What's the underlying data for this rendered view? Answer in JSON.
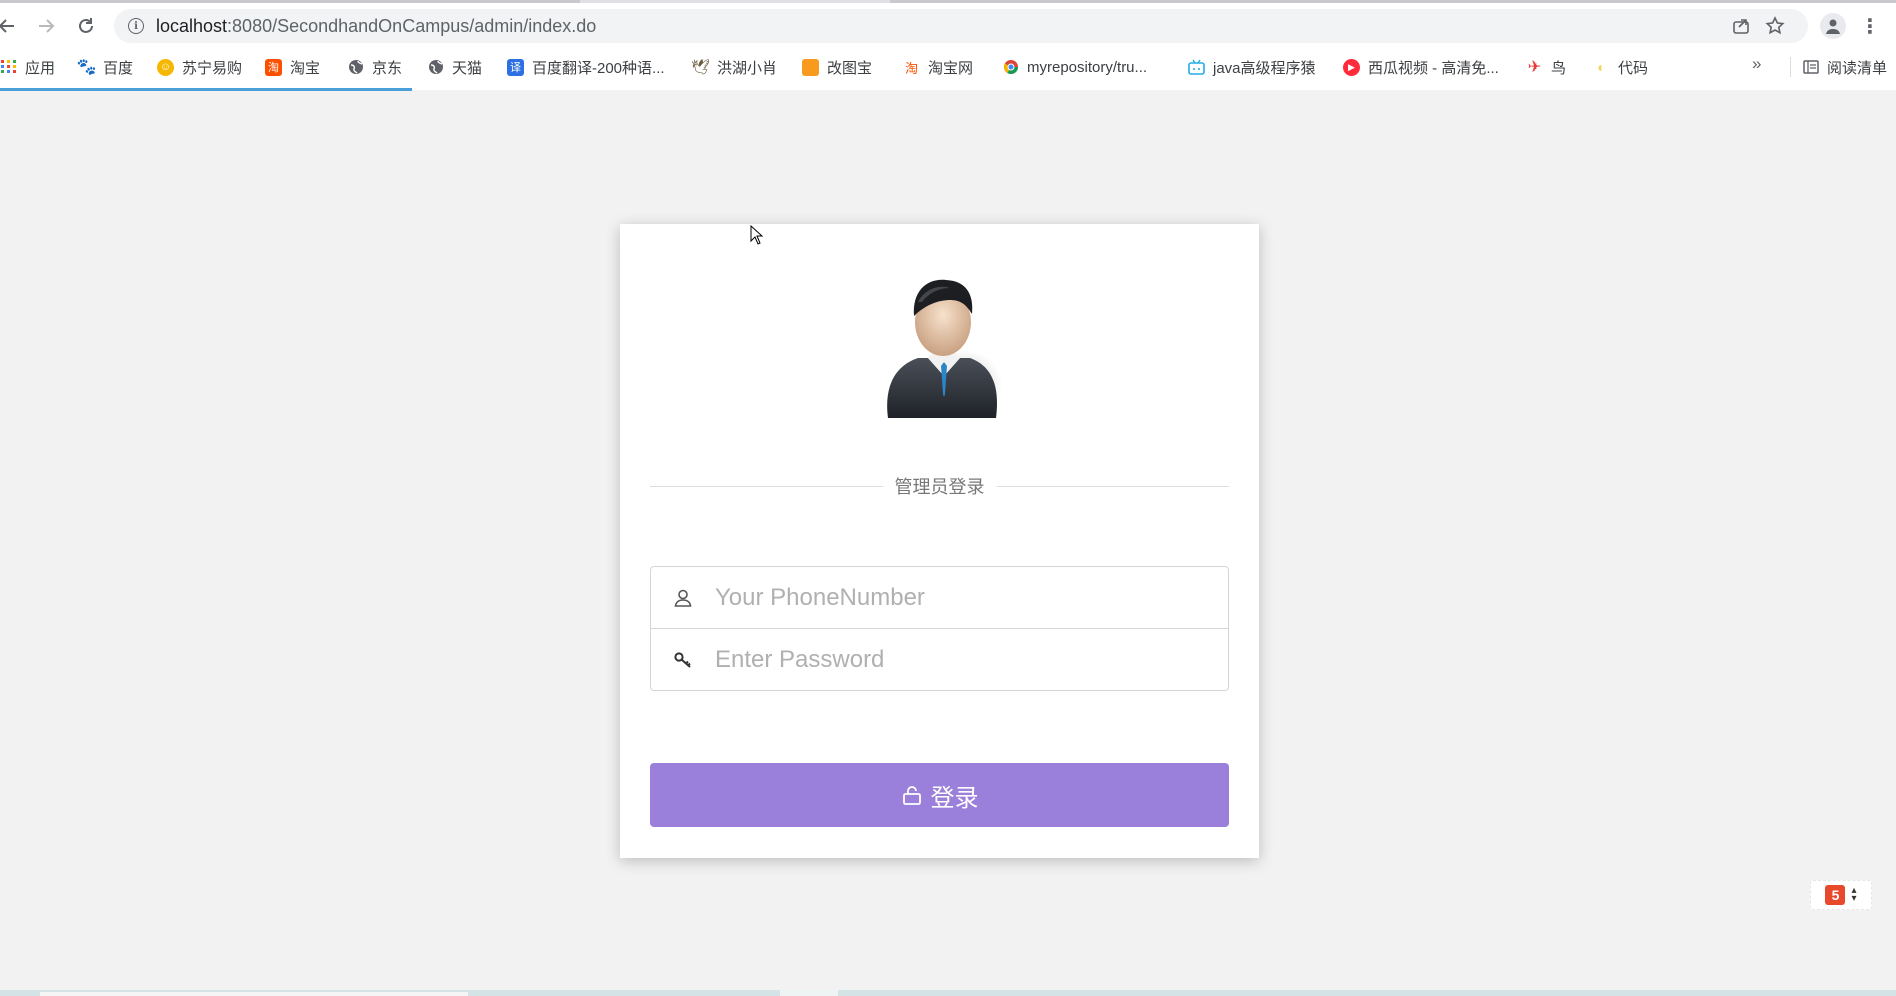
{
  "browser": {
    "url_host": "localhost",
    "url_path": ":8080/SecondhandOnCampus/admin/index.do",
    "bookmarks": [
      {
        "label": "应用",
        "icon": "apps-grid-icon"
      },
      {
        "label": "百度",
        "icon": "baidu-paw-icon"
      },
      {
        "label": "苏宁易购",
        "icon": "suning-lion-icon"
      },
      {
        "label": "淘宝",
        "icon": "taobao-icon"
      },
      {
        "label": "京东",
        "icon": "globe-icon"
      },
      {
        "label": "天猫",
        "icon": "globe-icon"
      },
      {
        "label": "百度翻译-200种语...",
        "icon": "translate-icon"
      },
      {
        "label": "洪湖小肖",
        "icon": "bird-icon"
      },
      {
        "label": "改图宝",
        "icon": "gaitubao-icon"
      },
      {
        "label": "淘宝网",
        "icon": "taobao-icon"
      },
      {
        "label": "myrepository/tru...",
        "icon": "chrome-icon"
      },
      {
        "label": "java高级程序猿",
        "icon": "bilibili-icon"
      },
      {
        "label": "西瓜视频 - 高清免...",
        "icon": "xigua-play-icon"
      },
      {
        "label": "鸟",
        "icon": "bird-red-icon"
      },
      {
        "label": "代码",
        "icon": "code-moon-icon"
      }
    ],
    "more_label": "»",
    "reading_list_label": "阅读清单"
  },
  "login": {
    "section_title": "管理员登录",
    "phone_placeholder": "Your PhoneNumber",
    "password_placeholder": "Enter Password",
    "login_button_label": "登录"
  },
  "colors": {
    "page_bg": "#f2f2f2",
    "button_bg": "#9a7fdb",
    "load_bar": "#4a9fd8"
  }
}
